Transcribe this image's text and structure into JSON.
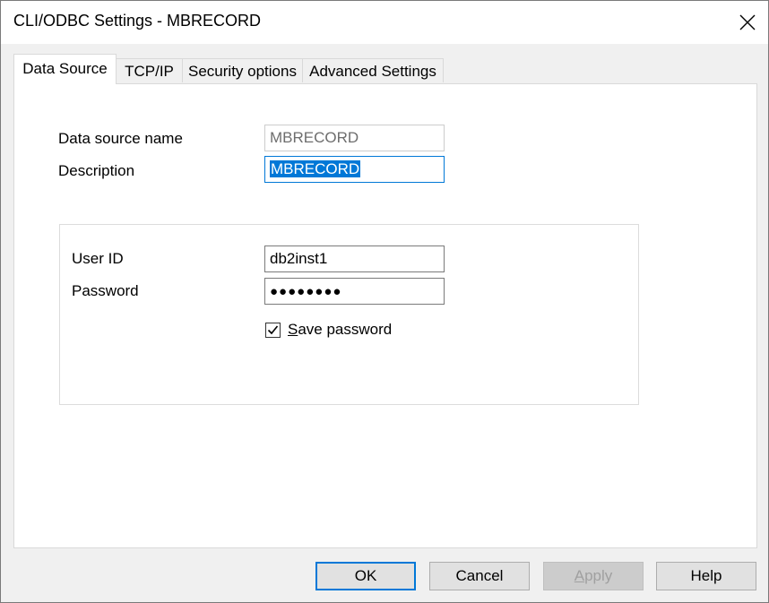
{
  "window": {
    "title": "CLI/ODBC Settings - MBRECORD"
  },
  "tabs": [
    {
      "label": "Data Source",
      "active": true
    },
    {
      "label": "TCP/IP",
      "active": false
    },
    {
      "label": "Security options",
      "active": false
    },
    {
      "label": "Advanced Settings",
      "active": false
    }
  ],
  "form": {
    "data_source_name_label": "Data source name",
    "data_source_name_value": "MBRECORD",
    "description_label": "Description",
    "description_value": "MBRECORD",
    "user_id_label": "User ID",
    "user_id_value": "db2inst1",
    "password_label": "Password",
    "password_mask": "●●●●●●●●",
    "save_password_accel": "S",
    "save_password_rest": "ave password",
    "save_password_checked": true
  },
  "buttons": {
    "ok": "OK",
    "cancel": "Cancel",
    "apply_accel": "A",
    "apply_rest": "pply",
    "help": "Help"
  },
  "colors": {
    "accent": "#0078d7",
    "window_bg": "#f0f0f0",
    "panel_bg": "#ffffff"
  }
}
